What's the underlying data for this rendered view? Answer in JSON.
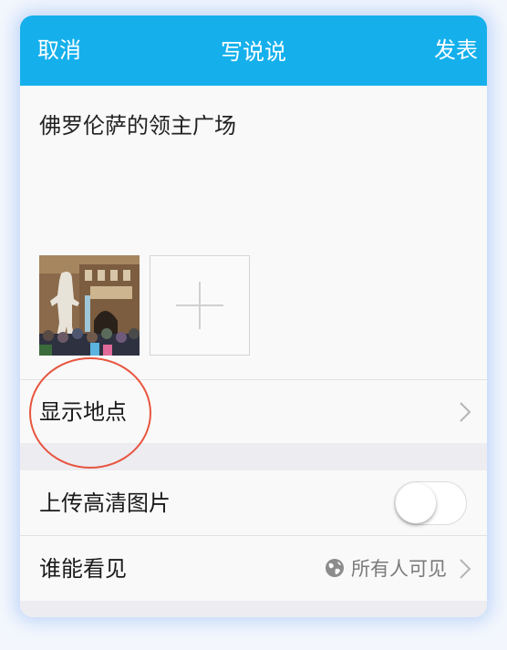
{
  "navbar": {
    "cancel_label": "取消",
    "title": "写说说",
    "publish_label": "发表",
    "background_color": "#15b0ec"
  },
  "post": {
    "text": "佛罗伦萨的领主广场"
  },
  "photos": {
    "add_icon": "plus-icon"
  },
  "rows": {
    "location_label": "显示地点",
    "hd_upload_label": "上传高清图片",
    "hd_upload_enabled": false,
    "visibility_label": "谁能看见",
    "visibility_value": "所有人可见",
    "visibility_icon": "globe-icon",
    "chevron_icon": "chevron-right-icon"
  },
  "annotation": {
    "color": "#e8553f"
  }
}
